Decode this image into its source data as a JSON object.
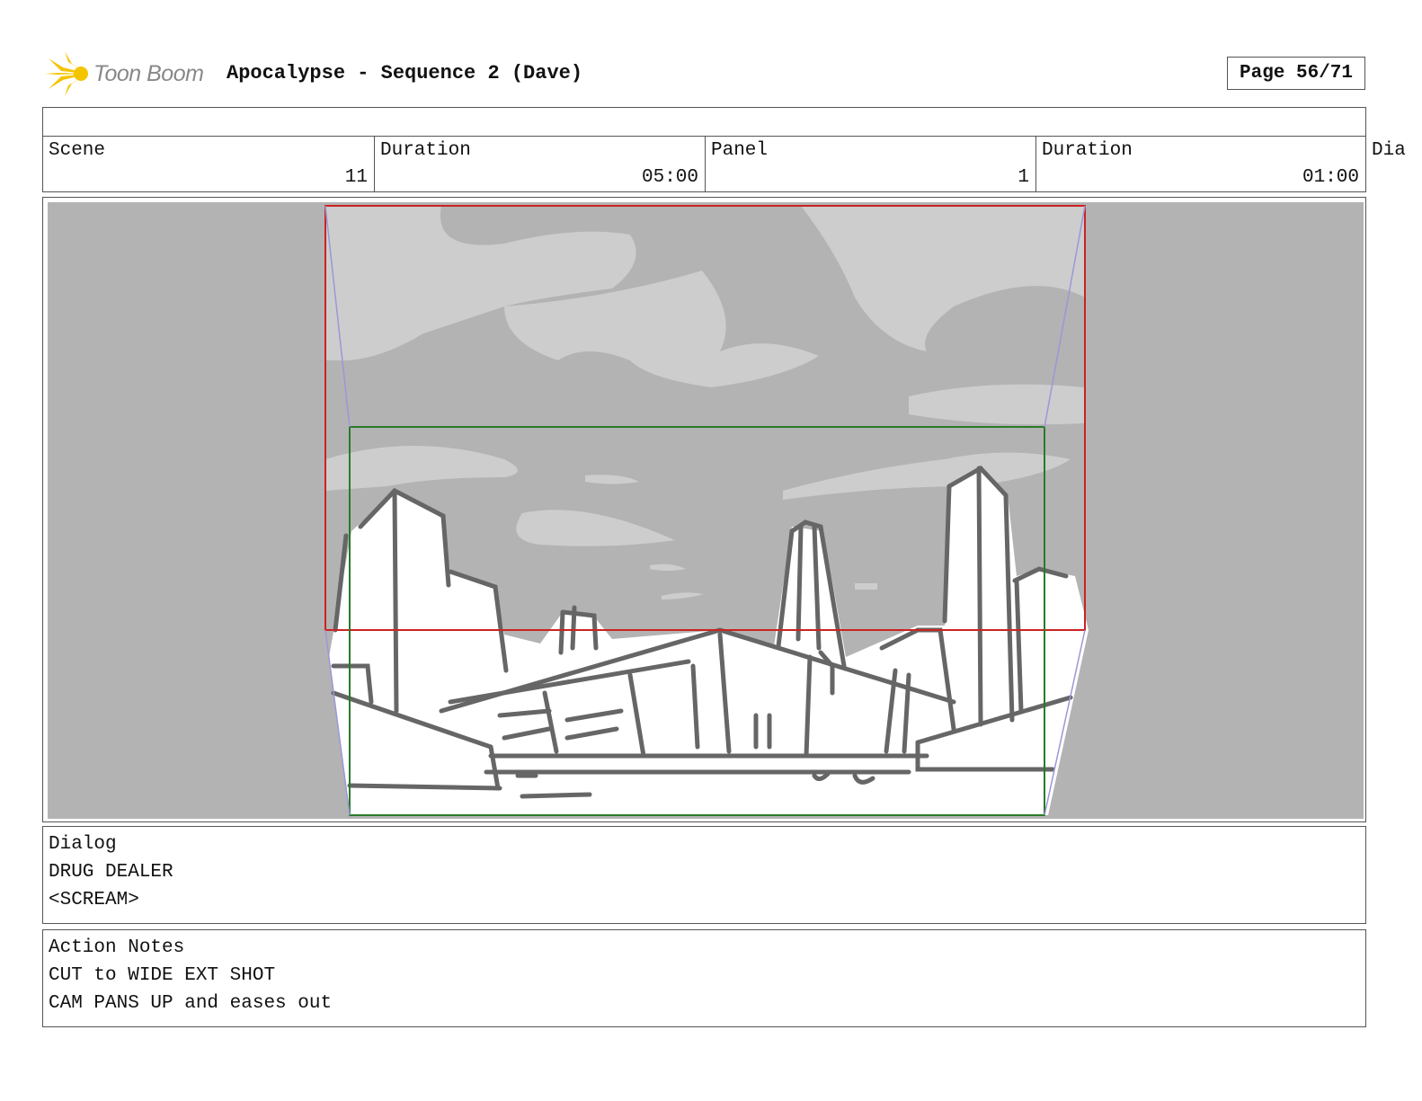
{
  "header": {
    "logo_text": "Toon Boom",
    "title": "Apocalypse - Sequence 2 (Dave)",
    "page": "Page 56/71"
  },
  "info": {
    "scene_label": "Scene",
    "scene_value": "11",
    "scene_duration_label": "Duration",
    "scene_duration_value": "05:00",
    "panel_label": "Panel",
    "panel_value": "1",
    "panel_duration_label": "Duration",
    "panel_duration_value": "01:00",
    "overflow_label": "Dia"
  },
  "colors": {
    "camera_start": "#cc2222",
    "camera_end": "#2a7a2a",
    "camera_path": "#9a98d8",
    "background": "#b3b3b3"
  },
  "dialog": {
    "label": "Dialog",
    "lines": [
      "DRUG DEALER",
      "<SCREAM>"
    ]
  },
  "action_notes": {
    "label": "Action Notes",
    "lines": [
      "CUT to WIDE EXT SHOT",
      "CAM PANS UP and eases out"
    ]
  }
}
